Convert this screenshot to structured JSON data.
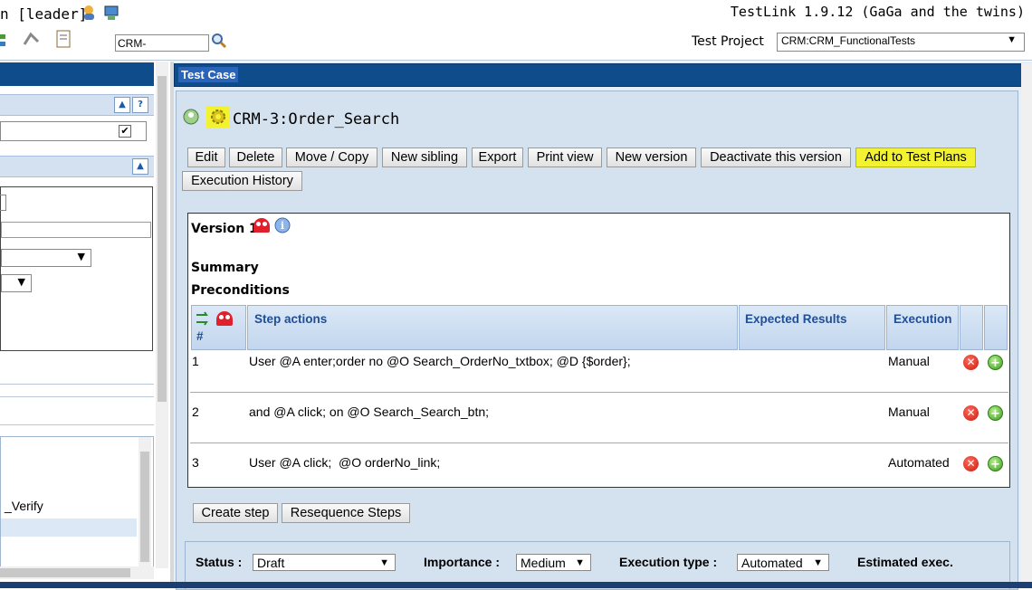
{
  "header": {
    "user_label": "n [leader]",
    "app_version": "TestLink 1.9.12 (GaGa and the twins)",
    "search_value": "CRM-",
    "project_label": "Test Project",
    "project_selected": "CRM:CRM_FunctionalTests"
  },
  "left_panel": {
    "tree_items": [
      "_Verify"
    ]
  },
  "test_case": {
    "panel_title": "Test Case",
    "title": "CRM-3:Order_Search",
    "buttons": {
      "edit": "Edit",
      "delete": "Delete",
      "move_copy": "Move / Copy",
      "new_sibling": "New sibling",
      "export": "Export",
      "print_view": "Print view",
      "new_version": "New version",
      "deactivate": "Deactivate this version",
      "add_to_test_plans": "Add to Test Plans",
      "execution_history": "Execution History"
    },
    "version_label": "Version 1",
    "summary_label": "Summary",
    "preconditions_label": "Preconditions",
    "steps_table": {
      "headers": {
        "number": "#",
        "step_actions": "Step actions",
        "expected_results": "Expected Results",
        "execution": "Execution"
      },
      "rows": [
        {
          "num": "1",
          "action": "User @A enter;order no @O Search_OrderNo_txtbox; @D {$order};",
          "expected": "",
          "execution": "Manual"
        },
        {
          "num": "2",
          "action": "and @A click; on @O Search_Search_btn;",
          "expected": "",
          "execution": "Manual"
        },
        {
          "num": "3",
          "action": "User @A click;  @O orderNo_link;",
          "expected": "",
          "execution": "Automated"
        }
      ]
    },
    "step_buttons": {
      "create_step": "Create step",
      "resequence": "Resequence Steps"
    },
    "attributes": {
      "status_label": "Status :",
      "status_value": "Draft",
      "importance_label": "Importance :",
      "importance_value": "Medium",
      "execution_type_label": "Execution type :",
      "execution_type_value": "Automated",
      "estimated_label": "Estimated exec."
    }
  },
  "colors": {
    "header_blue": "#0f4c8c",
    "panel_bg": "#d4e2f0",
    "highlight_yellow": "#f2f230"
  }
}
